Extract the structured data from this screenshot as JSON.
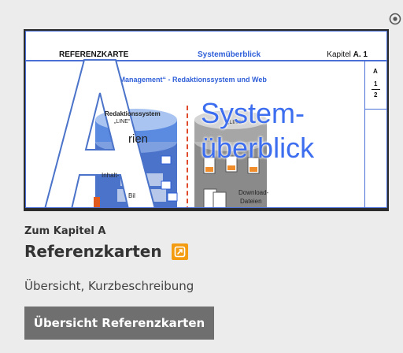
{
  "corner_icon": "radio-circle-icon",
  "image": {
    "header_left": "REFERENZKARTE",
    "header_center": "Systemüberblick",
    "header_right_prefix": "Kapitel ",
    "header_right_bold": "A. 1",
    "subtitle": "„C… Management“ - Redaktionssystem und Web",
    "side_letter": "A",
    "side_num_top": "1",
    "side_num_bottom": "2",
    "big_word_line1": "System-",
    "big_word_line2": "überblick",
    "big_letter": "A",
    "label_redaktionssystem": "Redaktionssystem",
    "label_line_left": "„LINE“",
    "label_dateien": "rien",
    "label_inhalt": "Inhalt-",
    "label_bilder": "Bil",
    "label_line_right": "„LINE“",
    "label_download": "Download-",
    "label_dateien2": "Dateien",
    "label_seiten": "lt-Seiten"
  },
  "chapter_link": "Zum Kapitel A",
  "title": "Referenzkarten",
  "external_icon": "external-link-icon",
  "description": "Übersicht, Kurzbeschreibung",
  "button_label": "Übersicht Referenzkarten",
  "colors": {
    "background": "#ececec",
    "accent_blue": "#3d6ef0",
    "badge_orange": "#f39c12",
    "button_gray": "#6f6f6f"
  }
}
